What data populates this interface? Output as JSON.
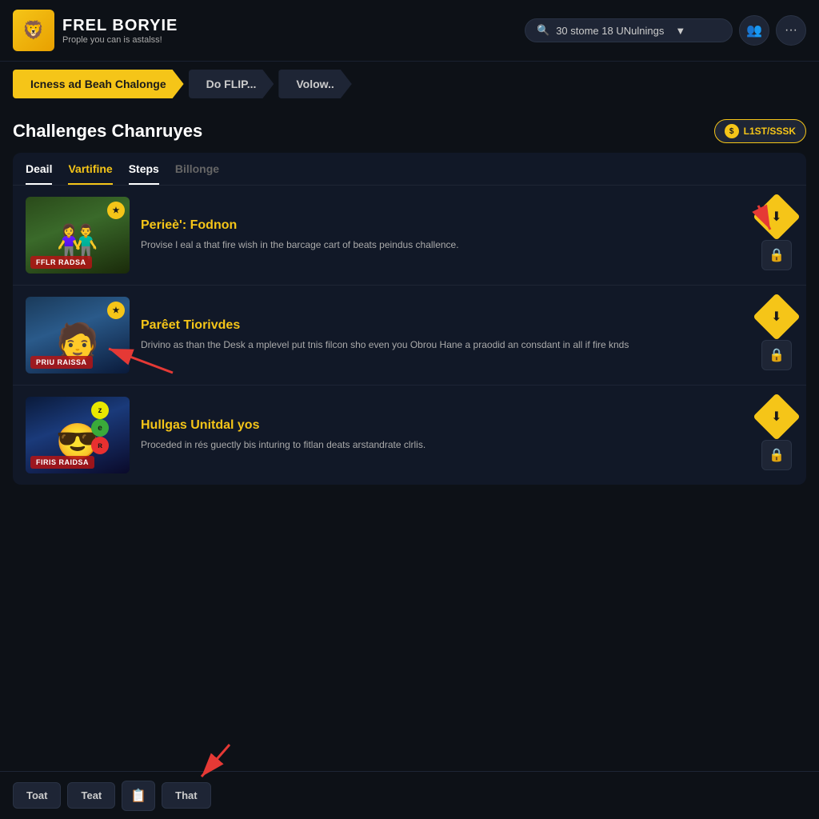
{
  "header": {
    "logo_icon": "🦁",
    "app_name": "FREL BORYIE",
    "app_tagline": "Prople you can is astalss!",
    "search_text": "30 stome 18 UNulnings",
    "users_icon": "👥",
    "more_icon": "···"
  },
  "nav_tabs": [
    {
      "label": "Icness ad Beah Chalonge",
      "active": true
    },
    {
      "label": "Do FLIP...",
      "active": false
    },
    {
      "label": "Volow..",
      "active": false
    }
  ],
  "section": {
    "title": "Challenges Chanruyes",
    "badge_label": "L1ST/SSSK"
  },
  "sub_tabs": [
    {
      "label": "Deail",
      "state": "active"
    },
    {
      "label": "Vartifine",
      "state": "yellow"
    },
    {
      "label": "Steps",
      "state": "active"
    },
    {
      "label": "Billonge",
      "state": "inactive"
    }
  ],
  "challenges": [
    {
      "thumb_label": "FFLR RADSA",
      "thumb_badge": "★",
      "title": "Perieè': Fodnon",
      "description": "Provise l eal a that fire wish in the barcage cart of beats peindus challence.",
      "has_top_arrow": true
    },
    {
      "thumb_label": "PRIU RAISSA",
      "thumb_badge": "★",
      "title": "Parêet Tiorivdes",
      "description": "Drivino as than the Desk a mplevel put tnis filcon sho even you Obrou Hane a praodid an consdant in all if fire knds",
      "has_top_arrow": false
    },
    {
      "thumb_label": "FIRIS RAIDSA",
      "thumb_badge": "z",
      "title": "Hullgas Unitdal yos",
      "description": "Proceded in rés guectly bis inturing to fitlan deats arstandrate clrlis.",
      "has_top_arrow": false
    }
  ],
  "bottom_bar": {
    "btn1": "Toat",
    "btn2": "Teat",
    "btn3_icon": "📋",
    "btn4": "That"
  }
}
